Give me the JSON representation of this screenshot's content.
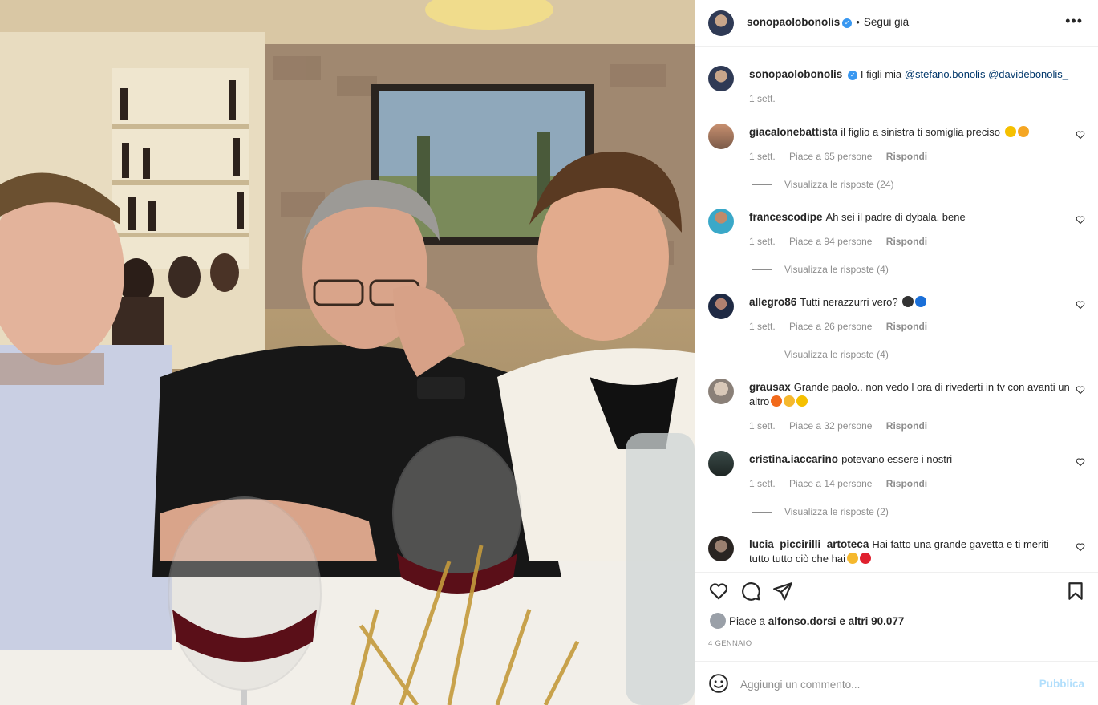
{
  "post": {
    "author": "sonopaolobonolis",
    "follow_status": "Segui già",
    "caption": {
      "author": "sonopaolobonolis",
      "text": "I figli mia",
      "mentions": [
        "@stefano.bonolis",
        "@davidebonolis_"
      ],
      "age": "1 sett."
    },
    "comments": [
      {
        "user": "giacalonebattista",
        "text": "il figlio a sinistra ti somiglia preciso",
        "emojis": [
          "star-struck",
          "hands-face"
        ],
        "age": "1 sett.",
        "likes": "Piace a 65 persone",
        "reply": "Rispondi",
        "replies": "Visualizza le risposte (24)"
      },
      {
        "user": "francescodipe",
        "text": "Ah sei il padre di dybala. bene",
        "emojis": [],
        "age": "1 sett.",
        "likes": "Piace a 94 persone",
        "reply": "Rispondi",
        "replies": "Visualizza le risposte (4)"
      },
      {
        "user": "allegro86",
        "text": "Tutti nerazzurri vero?",
        "emojis": [
          "black-circle",
          "blue-circle"
        ],
        "age": "1 sett.",
        "likes": "Piace a 26 persone",
        "reply": "Rispondi",
        "replies": "Visualizza le risposte (4)"
      },
      {
        "user": "grausax",
        "text": "Grande paolo.. non vedo l ora di rivederti in tv con avanti un altro",
        "emojis": [
          "fire",
          "clap",
          "star-struck"
        ],
        "age": "1 sett.",
        "likes": "Piace a 32 persone",
        "reply": "Rispondi",
        "replies": ""
      },
      {
        "user": "cristina.iaccarino",
        "text": "potevano essere i nostri",
        "emojis": [],
        "age": "1 sett.",
        "likes": "Piace a 14 persone",
        "reply": "Rispondi",
        "replies": "Visualizza le risposte (2)"
      },
      {
        "user": "lucia_piccirilli_artoteca",
        "text": "Hai fatto una grande gavetta e ti meriti tutto tutto ciò che hai",
        "emojis": [
          "clap",
          "red-heart"
        ],
        "age": "",
        "likes": "",
        "reply": "",
        "replies": ""
      }
    ],
    "likes_prefix": "Piace a",
    "likes_user": "alfonso.dorsi",
    "likes_suffix": "e altri 90.077",
    "date": "4 GENNAIO",
    "composer": {
      "placeholder": "Aggiungi un commento...",
      "publish": "Pubblica"
    }
  },
  "icons": {
    "more": "more-horizontal-icon",
    "like": "heart-icon",
    "comment": "comment-bubble-icon",
    "share": "paper-plane-icon",
    "save": "bookmark-icon",
    "emoji": "smiley-icon"
  },
  "colors": {
    "accent": "#3897f0",
    "mention": "#00376b",
    "muted": "#8e8e8e",
    "publish_disabled": "#b2dffc"
  }
}
